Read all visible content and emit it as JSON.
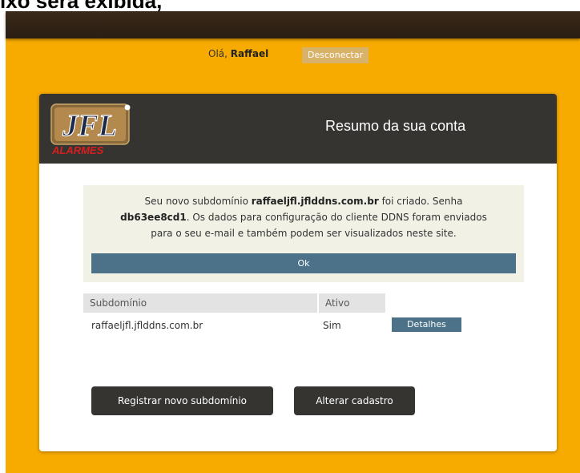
{
  "doc_caption": "ixo será exibida,",
  "header": {
    "greeting": "Olá,",
    "username": "Raffael",
    "logout_label": "Desconectar"
  },
  "card": {
    "logo_text": "JFL",
    "logo_sub": "ALARMES",
    "title": "Resumo da sua conta"
  },
  "notice": {
    "l1_a": "Seu novo subdomínio ",
    "l1_b": "raffaeljfl.jflddns.com.br",
    "l1_c": " foi criado. Senha",
    "l2_a": "db63ee8cd1",
    "l2_b": ". Os dados para configuração do cliente DDNS foram enviados",
    "l3": "para o seu e-mail e também podem ser visualizados neste site.",
    "ok_label": "Ok"
  },
  "table": {
    "col_subdomain": "Subdomínio",
    "col_active": "Ativo",
    "rows": [
      {
        "subdomain": "raffaeljfl.jflddns.com.br",
        "active": "Sim",
        "details_label": "Detalhes"
      }
    ]
  },
  "actions": {
    "register_label": "Registrar novo subdomínio",
    "edit_label": "Alterar cadastro"
  },
  "colors": {
    "background": "#f7ab00",
    "header_dark": "#353431",
    "accent_button": "#4b7288",
    "logout_button": "#d9b26a"
  }
}
